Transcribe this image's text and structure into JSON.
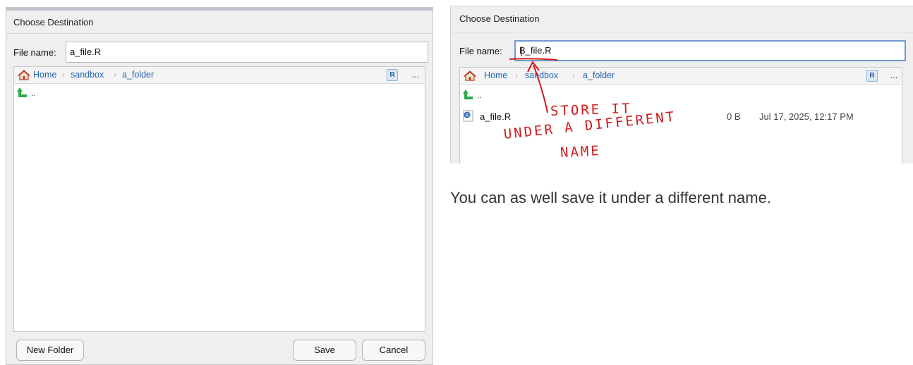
{
  "left_dialog": {
    "title": "Choose Destination",
    "file_name_label": "File name:",
    "file_name_value": "a_file.R",
    "breadcrumb": [
      "Home",
      "sandbox",
      "a_folder"
    ],
    "r_badge": "R",
    "more_label": "...",
    "parent_dir_label": "..",
    "buttons": {
      "new_folder": "New Folder",
      "save": "Save",
      "cancel": "Cancel"
    }
  },
  "right_dialog": {
    "title": "Choose Destination",
    "file_name_label": "File name:",
    "file_name_value": "B_file.R",
    "breadcrumb": [
      "Home",
      "sandbox",
      "a_folder"
    ],
    "r_badge": "R",
    "more_label": "...",
    "parent_dir_label": "..",
    "files": [
      {
        "name": "a_file.R",
        "size": "0 B",
        "modified": "Jul 17, 2025, 12:17 PM"
      }
    ]
  },
  "annotation": {
    "lines": [
      "STORE IT",
      "UNDER A DIFFERENT",
      "NAME"
    ],
    "color": "#d11c1c"
  },
  "caption": "You can as well save it under a different name.",
  "icons": {
    "home": "home-icon",
    "up": "up-arrow-icon",
    "r_file": "r-file-icon",
    "r_project": "r-project-icon"
  },
  "colors": {
    "link": "#2461b0",
    "dialog_bg": "#efefef",
    "focus_border": "#6f9ad1",
    "up_arrow": "#2eaa4f",
    "home_roof": "#c0392b"
  }
}
